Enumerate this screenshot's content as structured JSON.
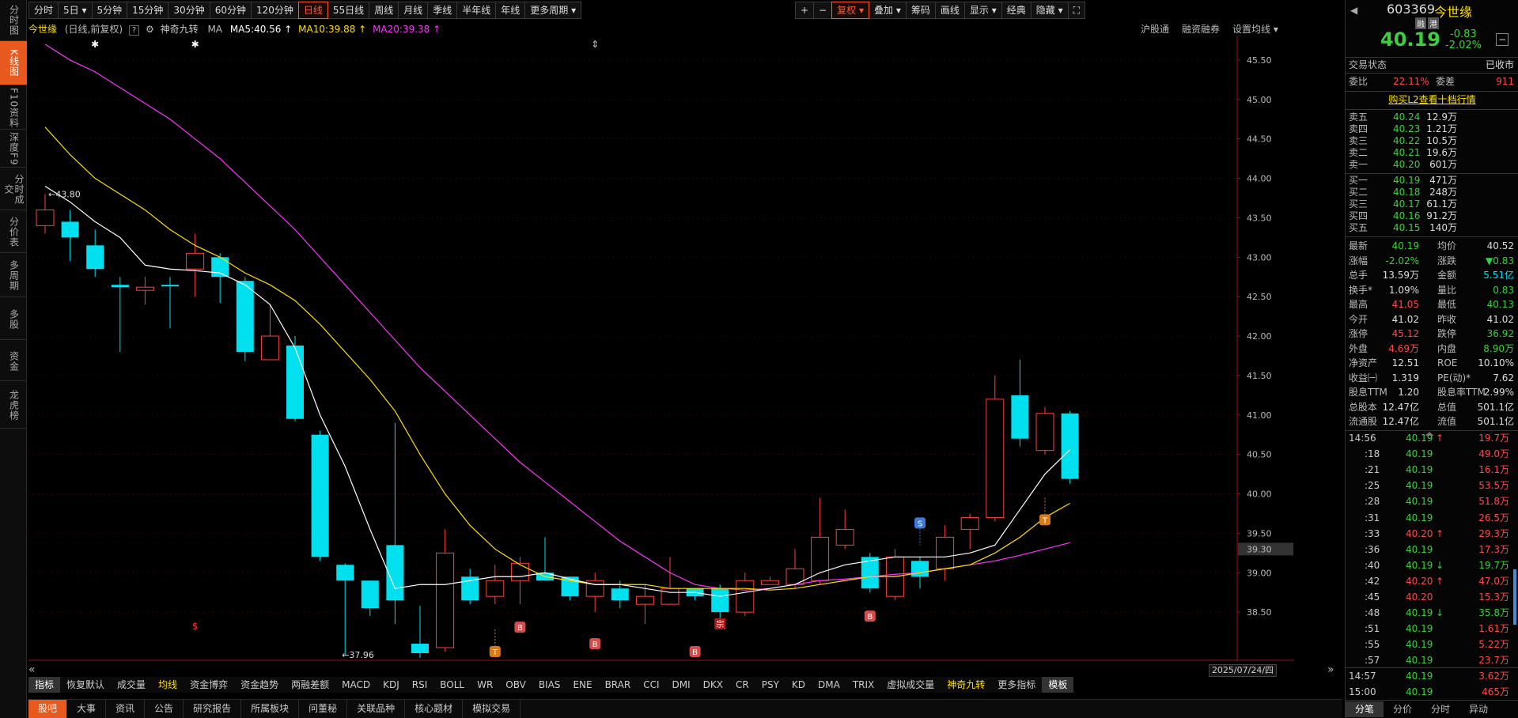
{
  "left_nav": [
    "分时图",
    "K线图",
    "F10资料",
    "深度F9",
    "分时成交",
    "分价表",
    "多周期",
    "多股",
    "资金",
    "龙虎榜"
  ],
  "top_tabs": [
    "分时",
    "5日 ▾",
    "5分钟",
    "15分钟",
    "30分钟",
    "60分钟",
    "120分钟",
    "日线",
    "55日线",
    "周线",
    "月线",
    "季线",
    "半年线",
    "年线",
    "更多周期 ▾"
  ],
  "top_right": [
    "+",
    "−",
    "复权 ▾",
    "叠加 ▾",
    "筹码",
    "画线",
    "显示 ▾",
    "经典",
    "隐藏 ▾",
    "⛶"
  ],
  "info": {
    "name": "今世缘",
    "mode": "(日线,前复权)",
    "q": "?",
    "gear": "⚙",
    "strategy": "神奇九转",
    "ma_lbl": "MA",
    "ma5": "MA5:40.56",
    "ma10": "MA10:39.88",
    "ma20": "MA20:39.38"
  },
  "right_links": [
    "沪股通",
    "融资融券",
    "设置均线 ▾"
  ],
  "chart_data": {
    "type": "candlestick",
    "y_ticks": [
      "45.50",
      "45.00",
      "44.50",
      "44.00",
      "43.50",
      "43.00",
      "42.50",
      "42.00",
      "41.50",
      "41.00",
      "40.50",
      "40.00",
      "39.50",
      "39.30",
      "39.00",
      "38.50"
    ],
    "ylim": [
      38.0,
      45.8
    ],
    "current_price": "39.30",
    "high_label": "43.80",
    "low_label": "37.96",
    "candles": [
      {
        "o": 43.4,
        "c": 43.6,
        "h": 43.8,
        "l": 43.3
      },
      {
        "o": 43.45,
        "c": 43.25,
        "h": 43.6,
        "l": 42.95
      },
      {
        "o": 43.15,
        "c": 42.85,
        "h": 43.35,
        "l": 42.75
      },
      {
        "o": 42.65,
        "c": 42.62,
        "h": 42.75,
        "l": 41.8
      },
      {
        "o": 42.58,
        "c": 42.62,
        "h": 42.75,
        "l": 42.4
      },
      {
        "o": 42.65,
        "c": 42.63,
        "h": 42.75,
        "l": 42.1
      },
      {
        "o": 42.85,
        "c": 43.05,
        "h": 43.3,
        "l": 42.5
      },
      {
        "o": 43.0,
        "c": 42.75,
        "h": 43.05,
        "l": 42.42
      },
      {
        "o": 42.7,
        "c": 41.8,
        "h": 42.75,
        "l": 41.68
      },
      {
        "o": 41.7,
        "c": 42.0,
        "h": 42.4,
        "l": 41.7
      },
      {
        "o": 41.88,
        "c": 40.95,
        "h": 42.0,
        "l": 40.92
      },
      {
        "o": 40.75,
        "c": 39.2,
        "h": 40.8,
        "l": 39.15
      },
      {
        "o": 39.1,
        "c": 38.9,
        "h": 39.12,
        "l": 37.96
      },
      {
        "o": 38.9,
        "c": 38.55,
        "h": 38.9,
        "l": 38.45
      },
      {
        "o": 39.35,
        "c": 38.65,
        "h": 40.9,
        "l": 38.35
      },
      {
        "o": 38.1,
        "c": 37.98,
        "h": 38.58,
        "l": 37.92
      },
      {
        "o": 38.05,
        "c": 39.25,
        "h": 39.55,
        "l": 38.0
      },
      {
        "o": 38.95,
        "c": 38.65,
        "h": 39.05,
        "l": 38.6
      },
      {
        "o": 38.7,
        "c": 38.9,
        "h": 39.1,
        "l": 38.6
      },
      {
        "o": 38.9,
        "c": 39.12,
        "h": 39.2,
        "l": 38.6
      },
      {
        "o": 39.0,
        "c": 38.9,
        "h": 39.45,
        "l": 38.9
      },
      {
        "o": 38.95,
        "c": 38.7,
        "h": 38.95,
        "l": 38.65
      },
      {
        "o": 38.7,
        "c": 38.9,
        "h": 39.0,
        "l": 38.5
      },
      {
        "o": 38.8,
        "c": 38.65,
        "h": 38.9,
        "l": 38.55
      },
      {
        "o": 38.6,
        "c": 38.7,
        "h": 38.85,
        "l": 38.35
      },
      {
        "o": 38.6,
        "c": 38.8,
        "h": 39.2,
        "l": 38.6
      },
      {
        "o": 38.8,
        "c": 38.7,
        "h": 38.8,
        "l": 38.65
      },
      {
        "o": 38.8,
        "c": 38.5,
        "h": 38.85,
        "l": 38.4
      },
      {
        "o": 38.5,
        "c": 38.9,
        "h": 39.0,
        "l": 38.45
      },
      {
        "o": 38.85,
        "c": 38.9,
        "h": 38.95,
        "l": 38.85
      },
      {
        "o": 38.85,
        "c": 39.05,
        "h": 39.3,
        "l": 38.8
      },
      {
        "o": 38.9,
        "c": 39.45,
        "h": 39.95,
        "l": 38.85
      },
      {
        "o": 39.35,
        "c": 39.55,
        "h": 39.8,
        "l": 39.3
      },
      {
        "o": 39.2,
        "c": 38.8,
        "h": 39.25,
        "l": 38.75
      },
      {
        "o": 38.7,
        "c": 39.2,
        "h": 39.3,
        "l": 38.65
      },
      {
        "o": 39.15,
        "c": 38.95,
        "h": 39.2,
        "l": 38.8
      },
      {
        "o": 39.05,
        "c": 39.45,
        "h": 39.6,
        "l": 38.9
      },
      {
        "o": 39.55,
        "c": 39.7,
        "h": 39.75,
        "l": 39.3
      },
      {
        "o": 39.7,
        "c": 41.2,
        "h": 41.5,
        "l": 39.65
      },
      {
        "o": 41.25,
        "c": 40.7,
        "h": 41.7,
        "l": 40.6
      },
      {
        "o": 40.55,
        "c": 41.02,
        "h": 41.1,
        "l": 40.5
      },
      {
        "o": 41.02,
        "c": 40.19,
        "h": 41.05,
        "l": 40.13
      }
    ],
    "ma5": [
      43.9,
      43.7,
      43.45,
      43.25,
      42.9,
      42.85,
      42.83,
      42.8,
      42.65,
      42.4,
      41.85,
      41.0,
      40.35,
      39.55,
      38.8,
      38.85,
      38.85,
      38.9,
      38.95,
      38.95,
      39.0,
      38.92,
      38.85,
      38.85,
      38.8,
      38.75,
      38.75,
      38.7,
      38.75,
      38.8,
      38.85,
      39.0,
      39.1,
      39.15,
      39.2,
      39.2,
      39.2,
      39.25,
      39.35,
      39.8,
      40.25,
      40.56
    ],
    "ma10": [
      44.65,
      44.3,
      44.0,
      43.8,
      43.6,
      43.35,
      43.15,
      43.0,
      42.8,
      42.65,
      42.45,
      42.15,
      41.8,
      41.45,
      41.05,
      40.5,
      40.0,
      39.6,
      39.3,
      39.1,
      38.95,
      38.9,
      38.85,
      38.85,
      38.85,
      38.8,
      38.8,
      38.8,
      38.8,
      38.78,
      38.8,
      38.85,
      38.9,
      38.95,
      38.95,
      39.0,
      39.05,
      39.1,
      39.25,
      39.45,
      39.7,
      39.88
    ],
    "ma20": [
      45.7,
      45.5,
      45.35,
      45.15,
      44.95,
      44.75,
      44.5,
      44.25,
      43.95,
      43.65,
      43.35,
      43.0,
      42.65,
      42.3,
      41.95,
      41.6,
      41.3,
      41.0,
      40.7,
      40.4,
      40.15,
      39.9,
      39.65,
      39.4,
      39.2,
      39.0,
      38.85,
      38.8,
      38.78,
      38.8,
      38.85,
      38.9,
      38.92,
      38.95,
      38.98,
      39.0,
      39.05,
      39.1,
      39.15,
      39.22,
      39.3,
      39.38
    ],
    "markers_top": [
      "✱",
      "✱",
      "⇕"
    ],
    "signals": [
      "B",
      "B",
      "T",
      "B",
      "B",
      "B",
      "S",
      "T",
      "B"
    ],
    "special": [
      "$",
      "宗"
    ]
  },
  "bottom_tabs": [
    "指标",
    "恢复默认",
    "成交量",
    "均线",
    "资金博弈",
    "资金趋势",
    "两融差额",
    "MACD",
    "KDJ",
    "RSI",
    "BOLL",
    "WR",
    "OBV",
    "BIAS",
    "ENE",
    "BRAR",
    "CCI",
    "DMI",
    "DKX",
    "CR",
    "PSY",
    "KD",
    "DMA",
    "TRIX",
    "虚拟成交量",
    "神奇九转",
    "更多指标",
    "模板"
  ],
  "bottom_bar": [
    "股吧",
    "大事",
    "资讯",
    "公告",
    "研究报告",
    "所属板块",
    "问董秘",
    "关联品种",
    "核心题材",
    "模拟交易"
  ],
  "date_label": "2025/07/24/四",
  "nav_arrows": {
    "left": "«",
    "right": "»"
  },
  "stock": {
    "code": "603369",
    "name": "今世缘",
    "tag1": "融",
    "tag2": "港",
    "price": "40.19",
    "change": "-0.83",
    "pct": "-2.02%",
    "minus": "−",
    "back": "◀"
  },
  "trade_state": {
    "label": "交易状态",
    "value": "已收市"
  },
  "ratio": {
    "l1": "委比",
    "v1": "22.11%",
    "l2": "委差",
    "v2": "911"
  },
  "buy_l2": "购买L2查看十档行情",
  "asks": [
    [
      "卖五",
      "40.24",
      "12.9万"
    ],
    [
      "卖四",
      "40.23",
      "1.21万"
    ],
    [
      "卖三",
      "40.22",
      "10.5万"
    ],
    [
      "卖二",
      "40.21",
      "19.6万"
    ],
    [
      "卖一",
      "40.20",
      "601万"
    ]
  ],
  "bids": [
    [
      "买一",
      "40.19",
      "471万"
    ],
    [
      "买二",
      "40.18",
      "248万"
    ],
    [
      "买三",
      "40.17",
      "61.1万"
    ],
    [
      "买四",
      "40.16",
      "91.2万"
    ],
    [
      "买五",
      "40.15",
      "140万"
    ]
  ],
  "stats": [
    [
      "最新",
      "40.19",
      "均价",
      "40.52"
    ],
    [
      "涨幅",
      "-2.02%",
      "涨跌",
      "▼0.83"
    ],
    [
      "总手",
      "13.59万",
      "金额",
      "5.51亿"
    ],
    [
      "换手*",
      "1.09%",
      "量比",
      "0.83"
    ],
    [
      "最高",
      "41.05",
      "最低",
      "40.13"
    ],
    [
      "今开",
      "41.02",
      "昨收",
      "41.02"
    ],
    [
      "涨停",
      "45.12",
      "跌停",
      "36.92"
    ],
    [
      "外盘",
      "4.69万",
      "内盘",
      "8.90万"
    ],
    [
      "净资产",
      "12.51",
      "ROE",
      "10.10%"
    ],
    [
      "收益㈠",
      "1.319",
      "PE(动)*",
      "7.62"
    ],
    [
      "股息TTM",
      "1.20",
      "股息率TTM",
      "2.99%"
    ],
    [
      "总股本",
      "12.47亿",
      "总值",
      "501.1亿"
    ],
    [
      "流通股",
      "12.47亿",
      "流值",
      "501.1亿"
    ]
  ],
  "ticks": [
    [
      "14:56",
      "40.19",
      "↑",
      "19.7万"
    ],
    [
      ":18",
      "40.19",
      "",
      "49.0万"
    ],
    [
      ":21",
      "40.19",
      "",
      "16.1万"
    ],
    [
      ":25",
      "40.19",
      "",
      "53.5万"
    ],
    [
      ":28",
      "40.19",
      "",
      "51.8万"
    ],
    [
      ":31",
      "40.19",
      "",
      "26.5万"
    ],
    [
      ":33",
      "40.20",
      "↑",
      "29.3万"
    ],
    [
      ":36",
      "40.19",
      "",
      "17.3万"
    ],
    [
      ":40",
      "40.19",
      "↓",
      "19.7万"
    ],
    [
      ":42",
      "40.20",
      "↑",
      "47.0万"
    ],
    [
      ":45",
      "40.20",
      "",
      "15.3万"
    ],
    [
      ":48",
      "40.19",
      "↓",
      "35.8万"
    ],
    [
      ":51",
      "40.19",
      "",
      "1.61万"
    ],
    [
      ":55",
      "40.19",
      "",
      "5.22万"
    ],
    [
      ":57",
      "40.19",
      "",
      "23.7万"
    ]
  ],
  "ticks2": [
    [
      "14:57",
      "40.19",
      "",
      "3.62万"
    ],
    [
      "15:00",
      "40.19",
      "",
      "465万"
    ]
  ],
  "panel_tabs": [
    "分笔",
    "分价",
    "分时",
    "异动"
  ]
}
